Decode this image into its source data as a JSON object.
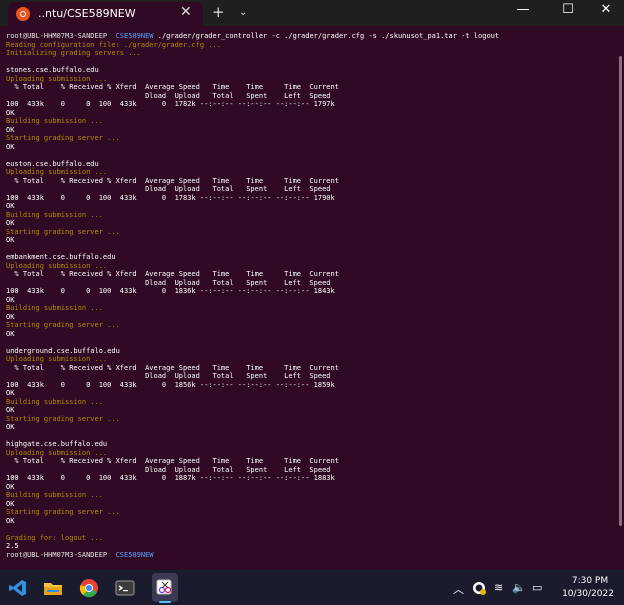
{
  "window": {
    "tab_title": "..ntu/CSE589NEW",
    "tab_close": "✕",
    "new_tab": "+",
    "dropdown": "⌄",
    "minimize": "—",
    "maximize": "☐",
    "close": "✕"
  },
  "terminal": {
    "lines": [
      {
        "segments": [
          {
            "t": "root@UBL-HHM07M3-SANDEEP",
            "c": "c-prompt"
          },
          {
            "t": "  CSE589NEW",
            "c": "c-path"
          },
          {
            "t": " ./grader/grader_controller -c ./grader/grader.cfg -s ./skunusot_pa1.tar -t logout",
            "c": "c-white"
          }
        ]
      },
      {
        "segments": [
          {
            "t": "Reading configuration file: ./grader/grader.cfg ...",
            "c": "c-dim"
          }
        ]
      },
      {
        "segments": [
          {
            "t": "Initializing grading servers ...",
            "c": "c-dim"
          }
        ]
      },
      {
        "segments": [
          {
            "t": "",
            "c": "c-white"
          }
        ]
      },
      {
        "segments": [
          {
            "t": "stones.cse.buffalo.edu",
            "c": "c-white"
          }
        ]
      },
      {
        "segments": [
          {
            "t": "Uploading submission ...",
            "c": "c-dim"
          }
        ]
      },
      {
        "segments": [
          {
            "t": "  % Total    % Received % Xferd  Average Speed   Time    Time     Time  Current",
            "c": "c-white"
          }
        ]
      },
      {
        "segments": [
          {
            "t": "                                 Dload  Upload   Total   Spent    Left  Speed",
            "c": "c-white"
          }
        ]
      },
      {
        "segments": [
          {
            "t": "100  433k    0     0  100  433k      0  1782k --:--:-- --:--:-- --:--:-- 1797k",
            "c": "c-white"
          }
        ]
      },
      {
        "segments": [
          {
            "t": "OK",
            "c": "c-white"
          }
        ]
      },
      {
        "segments": [
          {
            "t": "Building submission ...",
            "c": "c-dim"
          }
        ]
      },
      {
        "segments": [
          {
            "t": "OK",
            "c": "c-white"
          }
        ]
      },
      {
        "segments": [
          {
            "t": "Starting grading server ...",
            "c": "c-dim"
          }
        ]
      },
      {
        "segments": [
          {
            "t": "OK",
            "c": "c-white"
          }
        ]
      },
      {
        "segments": [
          {
            "t": "",
            "c": "c-white"
          }
        ]
      },
      {
        "segments": [
          {
            "t": "euston.cse.buffalo.edu",
            "c": "c-white"
          }
        ]
      },
      {
        "segments": [
          {
            "t": "Uploading submission ...",
            "c": "c-dim"
          }
        ]
      },
      {
        "segments": [
          {
            "t": "  % Total    % Received % Xferd  Average Speed   Time    Time     Time  Current",
            "c": "c-white"
          }
        ]
      },
      {
        "segments": [
          {
            "t": "                                 Dload  Upload   Total   Spent    Left  Speed",
            "c": "c-white"
          }
        ]
      },
      {
        "segments": [
          {
            "t": "100  433k    0     0  100  433k      0  1783k --:--:-- --:--:-- --:--:-- 1790k",
            "c": "c-white"
          }
        ]
      },
      {
        "segments": [
          {
            "t": "OK",
            "c": "c-white"
          }
        ]
      },
      {
        "segments": [
          {
            "t": "Building submission ...",
            "c": "c-dim"
          }
        ]
      },
      {
        "segments": [
          {
            "t": "OK",
            "c": "c-white"
          }
        ]
      },
      {
        "segments": [
          {
            "t": "Starting grading server ...",
            "c": "c-dim"
          }
        ]
      },
      {
        "segments": [
          {
            "t": "OK",
            "c": "c-white"
          }
        ]
      },
      {
        "segments": [
          {
            "t": "",
            "c": "c-white"
          }
        ]
      },
      {
        "segments": [
          {
            "t": "embankment.cse.buffalo.edu",
            "c": "c-white"
          }
        ]
      },
      {
        "segments": [
          {
            "t": "Uploading submission ...",
            "c": "c-dim"
          }
        ]
      },
      {
        "segments": [
          {
            "t": "  % Total    % Received % Xferd  Average Speed   Time    Time     Time  Current",
            "c": "c-white"
          }
        ]
      },
      {
        "segments": [
          {
            "t": "                                 Dload  Upload   Total   Spent    Left  Speed",
            "c": "c-white"
          }
        ]
      },
      {
        "segments": [
          {
            "t": "100  433k    0     0  100  433k      0  1836k --:--:-- --:--:-- --:--:-- 1843k",
            "c": "c-white"
          }
        ]
      },
      {
        "segments": [
          {
            "t": "OK",
            "c": "c-white"
          }
        ]
      },
      {
        "segments": [
          {
            "t": "Building submission ...",
            "c": "c-dim"
          }
        ]
      },
      {
        "segments": [
          {
            "t": "OK",
            "c": "c-white"
          }
        ]
      },
      {
        "segments": [
          {
            "t": "Starting grading server ...",
            "c": "c-dim"
          }
        ]
      },
      {
        "segments": [
          {
            "t": "OK",
            "c": "c-white"
          }
        ]
      },
      {
        "segments": [
          {
            "t": "",
            "c": "c-white"
          }
        ]
      },
      {
        "segments": [
          {
            "t": "underground.cse.buffalo.edu",
            "c": "c-white"
          }
        ]
      },
      {
        "segments": [
          {
            "t": "Uploading submission ...",
            "c": "c-dim"
          }
        ]
      },
      {
        "segments": [
          {
            "t": "  % Total    % Received % Xferd  Average Speed   Time    Time     Time  Current",
            "c": "c-white"
          }
        ]
      },
      {
        "segments": [
          {
            "t": "                                 Dload  Upload   Total   Spent    Left  Speed",
            "c": "c-white"
          }
        ]
      },
      {
        "segments": [
          {
            "t": "100  433k    0     0  100  433k      0  1856k --:--:-- --:--:-- --:--:-- 1859k",
            "c": "c-white"
          }
        ]
      },
      {
        "segments": [
          {
            "t": "OK",
            "c": "c-white"
          }
        ]
      },
      {
        "segments": [
          {
            "t": "Building submission ...",
            "c": "c-dim"
          }
        ]
      },
      {
        "segments": [
          {
            "t": "OK",
            "c": "c-white"
          }
        ]
      },
      {
        "segments": [
          {
            "t": "Starting grading server ...",
            "c": "c-dim"
          }
        ]
      },
      {
        "segments": [
          {
            "t": "OK",
            "c": "c-white"
          }
        ]
      },
      {
        "segments": [
          {
            "t": "",
            "c": "c-white"
          }
        ]
      },
      {
        "segments": [
          {
            "t": "highgate.cse.buffalo.edu",
            "c": "c-white"
          }
        ]
      },
      {
        "segments": [
          {
            "t": "Uploading submission ...",
            "c": "c-dim"
          }
        ]
      },
      {
        "segments": [
          {
            "t": "  % Total    % Received % Xferd  Average Speed   Time    Time     Time  Current",
            "c": "c-white"
          }
        ]
      },
      {
        "segments": [
          {
            "t": "                                 Dload  Upload   Total   Spent    Left  Speed",
            "c": "c-white"
          }
        ]
      },
      {
        "segments": [
          {
            "t": "100  433k    0     0  100  433k      0  1887k --:--:-- --:--:-- --:--:-- 1883k",
            "c": "c-white"
          }
        ]
      },
      {
        "segments": [
          {
            "t": "OK",
            "c": "c-white"
          }
        ]
      },
      {
        "segments": [
          {
            "t": "Building submission ...",
            "c": "c-dim"
          }
        ]
      },
      {
        "segments": [
          {
            "t": "OK",
            "c": "c-white"
          }
        ]
      },
      {
        "segments": [
          {
            "t": "Starting grading server ...",
            "c": "c-dim"
          }
        ]
      },
      {
        "segments": [
          {
            "t": "OK",
            "c": "c-white"
          }
        ]
      },
      {
        "segments": [
          {
            "t": "",
            "c": "c-white"
          }
        ]
      },
      {
        "segments": [
          {
            "t": "Grading for: logout ...",
            "c": "c-dim"
          }
        ]
      },
      {
        "segments": [
          {
            "t": "2.5",
            "c": "c-white"
          }
        ]
      },
      {
        "segments": [
          {
            "t": "root@UBL-HHM07M3-SANDEEP",
            "c": "c-prompt"
          },
          {
            "t": "  CSE589NEW",
            "c": "c-path"
          }
        ]
      }
    ]
  },
  "taskbar": {
    "apps": [
      {
        "name": "vscode-icon",
        "color": "#2f8fe0"
      },
      {
        "name": "file-explorer-icon",
        "color": "#f4c542"
      },
      {
        "name": "chrome-icon",
        "color": "#34a853"
      },
      {
        "name": "terminal-icon",
        "color": "#4a4a4a"
      },
      {
        "name": "snipping-tool-icon",
        "color": "#7a7aff"
      }
    ],
    "tray": {
      "chevron": "︿",
      "wifi": "≋",
      "volume": "🔈",
      "battery": "▭"
    },
    "time": "7:30 PM",
    "date": "10/30/2022"
  }
}
